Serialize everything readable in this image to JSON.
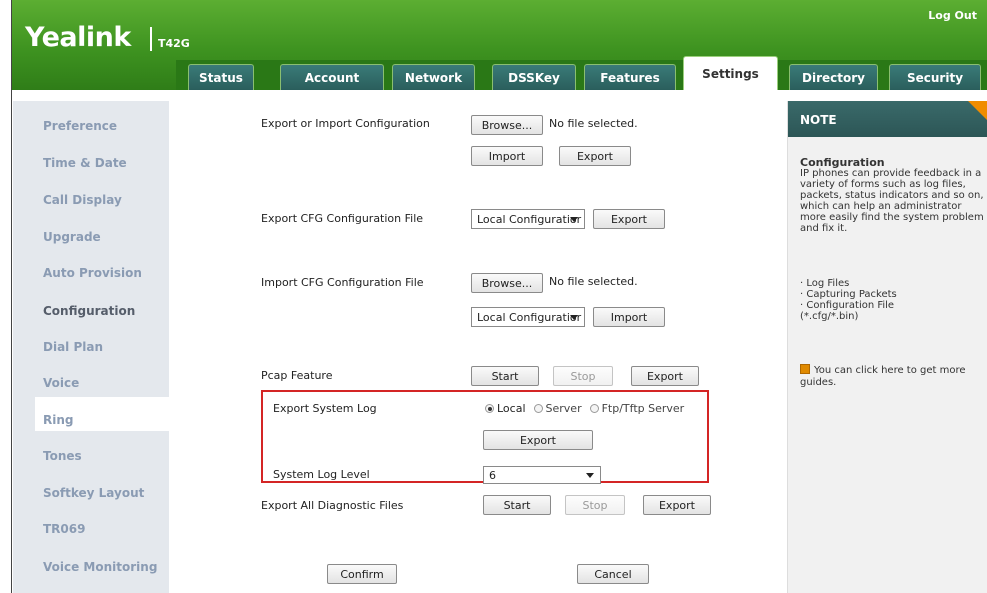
{
  "header": {
    "brand": "Yealink",
    "model": "T42G",
    "logout": "Log Out"
  },
  "tabs": [
    "Status",
    "Account",
    "Network",
    "DSSKey",
    "Features",
    "Settings",
    "Directory",
    "Security"
  ],
  "active_tab": "Settings",
  "sidebar": {
    "items": [
      "Preference",
      "Time & Date",
      "Call Display",
      "Upgrade",
      "Auto Provision",
      "Configuration",
      "Dial Plan",
      "Voice",
      "Ring",
      "Tones",
      "Softkey Layout",
      "TR069",
      "Voice Monitoring"
    ],
    "active": "Configuration"
  },
  "main": {
    "export_import": {
      "label": "Export or Import Configuration",
      "browse": "Browse...",
      "file_status": "No file selected.",
      "import": "Import",
      "export": "Export"
    },
    "export_cfg": {
      "label": "Export CFG Configuration File",
      "select": "Local Configuratior",
      "export": "Export"
    },
    "import_cfg": {
      "label": "Import CFG Configuration File",
      "browse": "Browse...",
      "file_status": "No file selected.",
      "select": "Local Configuratior",
      "import": "Import"
    },
    "pcap": {
      "label": "Pcap Feature",
      "start": "Start",
      "stop": "Stop",
      "export": "Export"
    },
    "system_log": {
      "label": "Export System Log",
      "options": [
        "Local",
        "Server",
        "Ftp/Tftp Server"
      ],
      "selected": "Local",
      "export": "Export"
    },
    "log_level": {
      "label": "System Log Level",
      "value": "6"
    },
    "diagnostic": {
      "label": "Export All Diagnostic Files",
      "start": "Start",
      "stop": "Stop",
      "export": "Export"
    },
    "confirm": "Confirm",
    "cancel": "Cancel"
  },
  "note": {
    "title": "NOTE",
    "heading": "Configuration",
    "body": "IP phones can provide feedback in a variety of forms such as log files, packets, status indicators and so on, which can help an administrator more easily find the system problem and fix it.",
    "bullets": [
      "Log Files",
      "Capturing Packets",
      "Configuration File",
      "(*.cfg/*.bin)"
    ],
    "guide": "You can click here to get more guides."
  },
  "colors": {
    "header_green": "#3e9320",
    "highlight_box": "#d42525",
    "note_header": "#2c5656",
    "note_corner": "#f08c00"
  }
}
